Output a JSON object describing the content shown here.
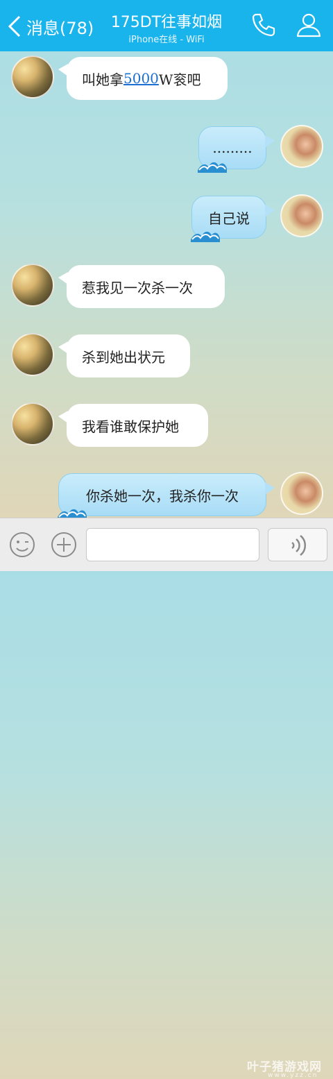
{
  "header": {
    "back_label": "消息(78)",
    "title": "175DT往事如烟",
    "subtitle": "iPhone在线 - WiFi",
    "background": "#19b4ec"
  },
  "messages": [
    {
      "side": "left",
      "text_before": "叫她拿",
      "link": "5000",
      "text_after": "W衮吧"
    },
    {
      "side": "right",
      "text": "........."
    },
    {
      "side": "right",
      "text": "自己说"
    },
    {
      "side": "left",
      "text": "惹我见一次杀一次"
    },
    {
      "side": "left",
      "text": "杀到她出状元"
    },
    {
      "side": "left",
      "text": "我看谁敢保护她"
    },
    {
      "side": "right",
      "text": "你杀她一次，我杀你一次"
    }
  ],
  "input_bar": {
    "emoji_icon": "emoji-icon",
    "plus_icon": "plus-icon",
    "voice_icon": "voice-icon"
  },
  "watermark": {
    "main": "叶子猪游戏网",
    "sub": "www.yzz.cn"
  }
}
